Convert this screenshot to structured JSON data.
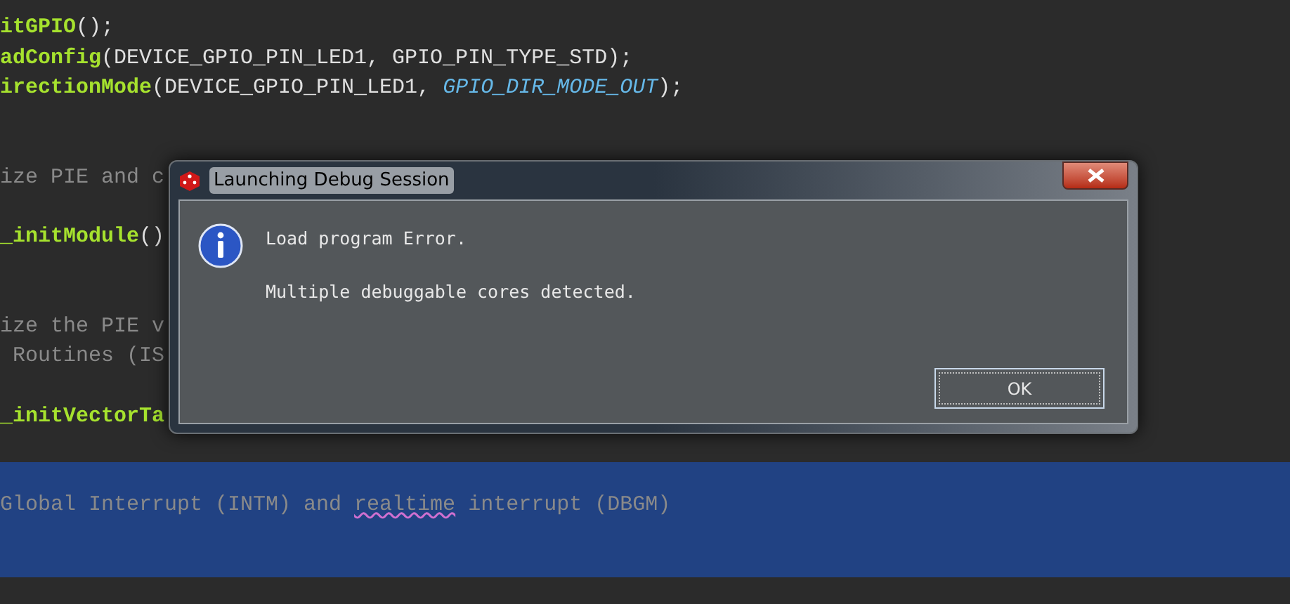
{
  "editor": {
    "lines": [
      {
        "selected": false,
        "segments": [
          {
            "kind": "fn",
            "text": "itGPIO"
          },
          {
            "kind": "plain",
            "text": "();"
          }
        ]
      },
      {
        "selected": false,
        "segments": [
          {
            "kind": "fn",
            "text": "adConfig"
          },
          {
            "kind": "plain",
            "text": "(DEVICE_GPIO_PIN_LED1, GPIO_PIN_TYPE_STD);"
          }
        ]
      },
      {
        "selected": false,
        "segments": [
          {
            "kind": "fn",
            "text": "irectionMode"
          },
          {
            "kind": "plain",
            "text": "(DEVICE_GPIO_PIN_LED1, "
          },
          {
            "kind": "const",
            "text": "GPIO_DIR_MODE_OUT"
          },
          {
            "kind": "plain",
            "text": ");"
          }
        ]
      },
      {
        "selected": false
      },
      {
        "selected": false
      },
      {
        "selected": false,
        "segments": [
          {
            "kind": "comment",
            "text": "ize PIE and c"
          }
        ]
      },
      {
        "selected": false
      },
      {
        "selected": false,
        "segments": [
          {
            "kind": "fn",
            "text": "_initModule"
          },
          {
            "kind": "plain",
            "text": "()"
          }
        ]
      },
      {
        "selected": false
      },
      {
        "selected": false
      },
      {
        "selected": false,
        "segments": [
          {
            "kind": "comment",
            "text": "ize the PIE v"
          }
        ]
      },
      {
        "selected": false,
        "segments": [
          {
            "kind": "comment",
            "text": " Routines (IS"
          }
        ]
      },
      {
        "selected": false
      },
      {
        "selected": false,
        "segments": [
          {
            "kind": "fn",
            "text": "_initVectorTa"
          }
        ]
      },
      {
        "selected": false
      },
      {
        "selected": true,
        "segments": [
          {
            "kind": "comment",
            "text": "Global Interrupt (INTM) and "
          },
          {
            "kind": "misspelled",
            "text": "realtime"
          },
          {
            "kind": "comment",
            "text": " interrupt (DBGM)"
          }
        ]
      }
    ]
  },
  "dialog": {
    "title": "Launching Debug Session",
    "messages": [
      "Load program Error.",
      "Multiple debuggable cores detected."
    ],
    "button": "OK"
  }
}
